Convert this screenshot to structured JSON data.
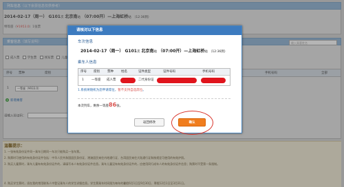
{
  "background": {
    "train_panel_title": "列车信息",
    "train_panel_subtitle": "（以下余票信息仅供参考）",
    "train_summary": {
      "date": "2014-02-17（周一）",
      "train_no": "G101",
      "train_suffix": "次",
      "from": "北京南",
      "from_suffix": "站",
      "depart": "（07:00开）",
      "arrow": "—",
      "to": "上海虹桥",
      "to_suffix": "站",
      "arrive": "（12:36到）"
    },
    "seat_line_prefix": "特等座（",
    "seat_line_price": "¥1953.0",
    "seat_line_suffix": "）1张票",
    "passenger_panel_title": "乘客信息",
    "passenger_panel_subtitle": "（填写说明）",
    "search_placeholder": "输入乘客姓名",
    "passenger_tags": [
      "成人票",
      "学生票",
      "残军票",
      "儿童票"
    ],
    "table_headers": [
      "序号",
      "票种",
      "席别",
      "姓名",
      "证件类型",
      "证件号码",
      "手机号码",
      "全部"
    ],
    "row_no": "1",
    "row_seat_select": "一等座（¥933.0）",
    "add_passenger_label": "新增乘客",
    "verify_label": "请输入验证码：",
    "tips_title": "温馨提示：",
    "tips": [
      "1. 一张有效身份证件同一乘车日期同一车次只能购买一张车票。",
      "2. 购票时可使用的有效身份证件包括：中华人民共和国居民身份证、港澳居民来往内地通行证、台湾居民来往大陆通行证和按规定可使用的有效护照。",
      "3. 购买儿童票时，乘车儿童有有效身份证件的，请填写本人有效身份证件信息。乘车儿童没有有效身份证件的，应使用同行成年人的有效身份证件信息；购票时不受第一条限制。",
      "4. 购买学生票时，须在我的常用联系人中登记乘车人的学生详细信息。学生票乘车时间限为每年的暑假6月1日至9月30日、寒假12月1日至3月31日。"
    ]
  },
  "modal": {
    "title": "请核对以下信息",
    "train_section": "车次信息",
    "train_summary": {
      "date": "2014-02-17（周一）",
      "train_no": "G101",
      "train_suffix": "次",
      "from": "北京南",
      "from_suffix": "站",
      "depart": "（07:00开）",
      "arrow": "—",
      "to": "上海虹桥",
      "to_suffix": "站",
      "arrive": "（12:36到）"
    },
    "passenger_section": "乘车人信息",
    "table_headers": [
      "序号",
      "席别",
      "票种",
      "姓名",
      "证件类型",
      "证件号码",
      "手机号码"
    ],
    "row": {
      "no": "1",
      "seat": "一等座",
      "ticket_type": "成人票",
      "id_type": "二代身份证"
    },
    "notice_prefix": "1.系统将随机为您申请席位，",
    "notice_red": "暂不支持自选席位",
    "notice_suffix": "。",
    "remain_prefix": "本次列车，剩余一等座",
    "remain_count": "86",
    "remain_suffix": "张。",
    "back_button": "返回修改",
    "confirm_button": "确认"
  },
  "colors": {
    "modal_header": "#3d7bbf",
    "confirm_button": "#f07d1e",
    "redaction": "#e0141c",
    "highlight_red": "#d9534f"
  }
}
